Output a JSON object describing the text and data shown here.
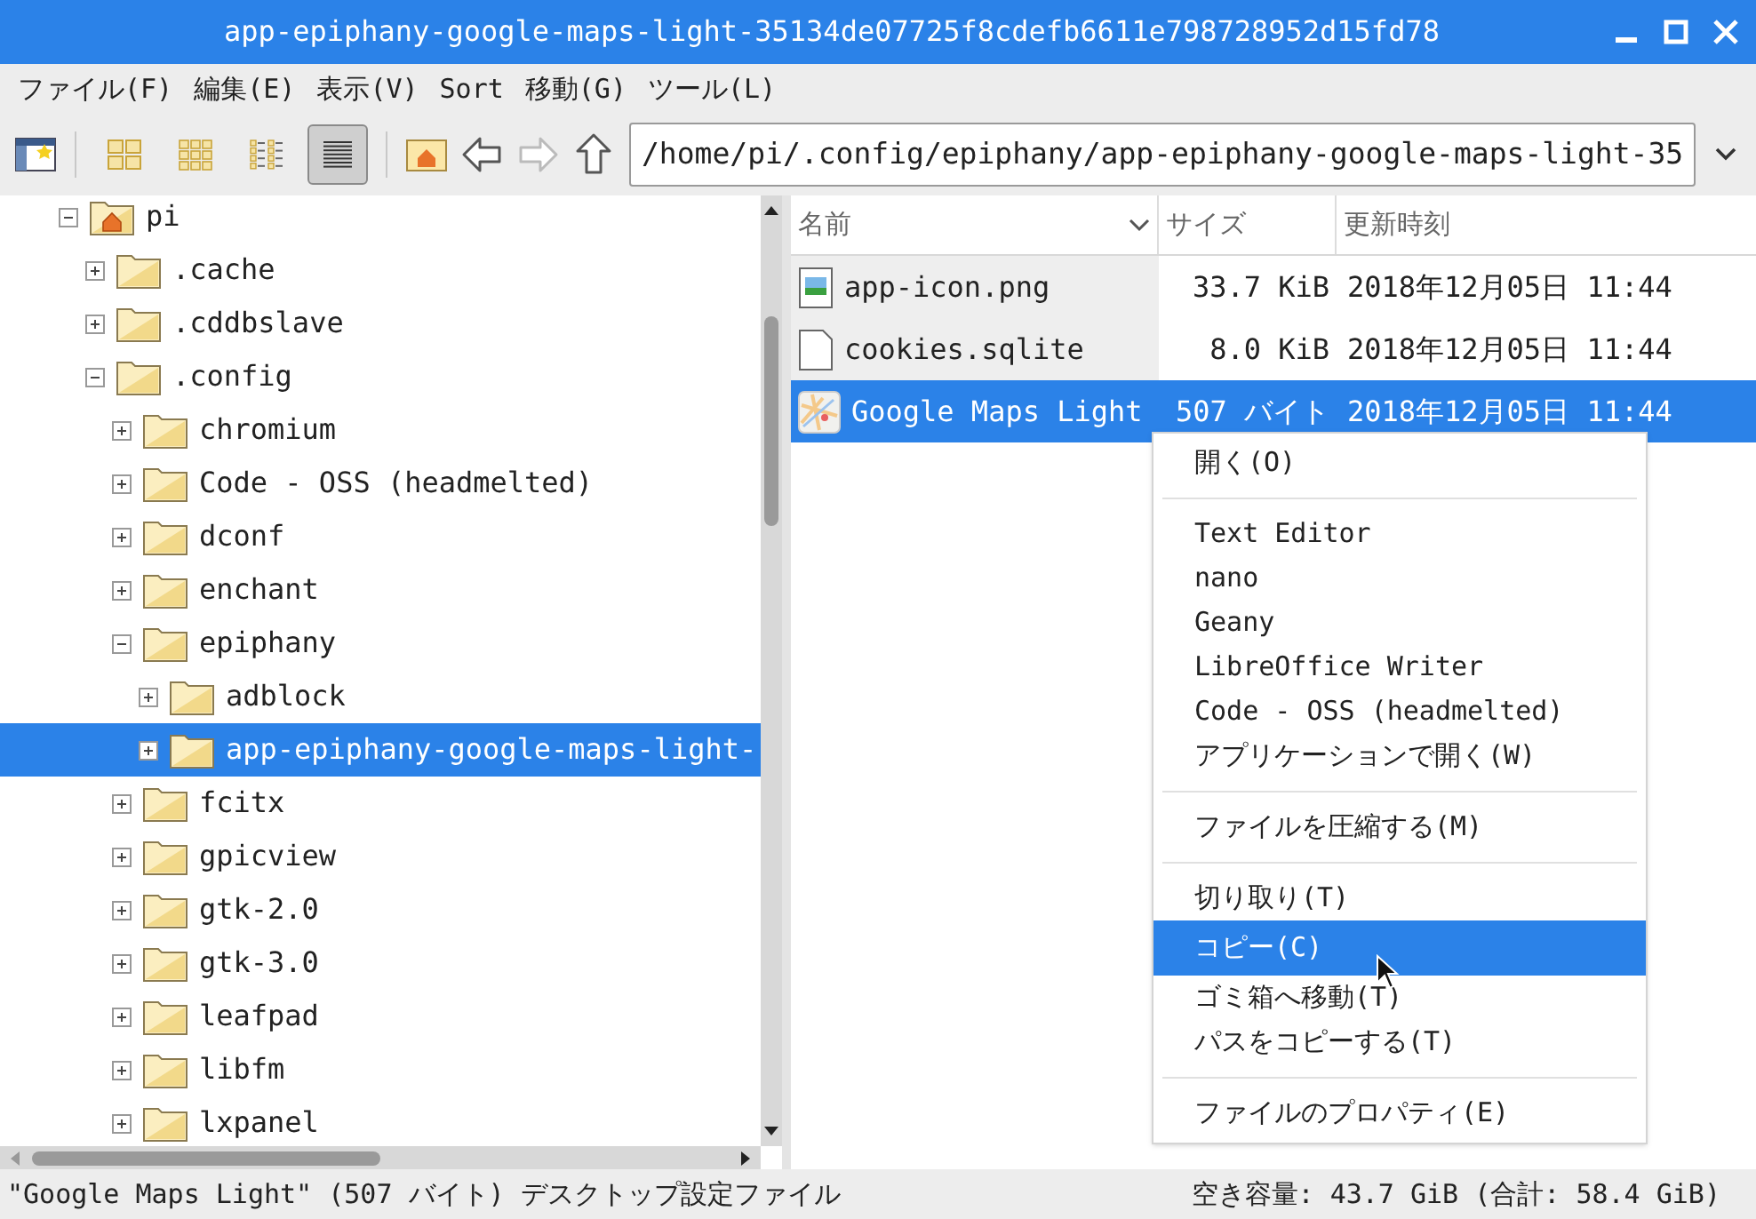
{
  "window": {
    "title": "app-epiphany-google-maps-light-35134de07725f8cdefb6611e798728952d15fd78"
  },
  "menu_bar": [
    "ファイル(F)",
    "編集(E)",
    "表示(V)",
    "Sort",
    "移動(G)",
    "ツール(L)"
  ],
  "toolbar": {
    "view_buttons": [
      {
        "kind": "icons",
        "selected": false
      },
      {
        "kind": "thumbnails",
        "selected": false
      },
      {
        "kind": "compact",
        "selected": false
      },
      {
        "kind": "list",
        "selected": true
      }
    ],
    "forward_disabled": true,
    "path": "/home/pi/.config/epiphany/app-epiphany-google-maps-light-35"
  },
  "tree": [
    {
      "label": "pi",
      "kind": "home",
      "expanded": true,
      "selected": false,
      "children": [
        {
          "label": ".cache",
          "kind": "folder",
          "expanded": false,
          "selected": false
        },
        {
          "label": ".cddbslave",
          "kind": "folder",
          "expanded": false,
          "selected": false
        },
        {
          "label": ".config",
          "kind": "folder",
          "expanded": true,
          "selected": false,
          "children": [
            {
              "label": "chromium",
              "kind": "folder",
              "expanded": false,
              "selected": false
            },
            {
              "label": "Code - OSS (headmelted)",
              "kind": "folder",
              "expanded": false,
              "selected": false
            },
            {
              "label": "dconf",
              "kind": "folder",
              "expanded": false,
              "selected": false
            },
            {
              "label": "enchant",
              "kind": "folder",
              "expanded": false,
              "selected": false
            },
            {
              "label": "epiphany",
              "kind": "folder",
              "expanded": true,
              "selected": false,
              "children": [
                {
                  "label": "adblock",
                  "kind": "folder",
                  "expanded": false,
                  "selected": false
                },
                {
                  "label": "app-epiphany-google-maps-light-",
                  "kind": "folder",
                  "expanded": false,
                  "selected": true
                }
              ]
            },
            {
              "label": "fcitx",
              "kind": "folder",
              "expanded": false,
              "selected": false
            },
            {
              "label": "gpicview",
              "kind": "folder",
              "expanded": false,
              "selected": false
            },
            {
              "label": "gtk-2.0",
              "kind": "folder",
              "expanded": false,
              "selected": false
            },
            {
              "label": "gtk-3.0",
              "kind": "folder",
              "expanded": false,
              "selected": false
            },
            {
              "label": "leafpad",
              "kind": "folder",
              "expanded": false,
              "selected": false
            },
            {
              "label": "libfm",
              "kind": "folder",
              "expanded": false,
              "selected": false
            },
            {
              "label": "lxpanel",
              "kind": "folder",
              "expanded": false,
              "selected": false
            }
          ]
        }
      ]
    }
  ],
  "table": {
    "columns": [
      "名前",
      "サイズ",
      "更新時刻"
    ],
    "rows": [
      {
        "kind": "image",
        "name": "app-icon.png",
        "size": "33.7 KiB",
        "modified": "2018年12月05日 11:44",
        "selected": false
      },
      {
        "kind": "file",
        "name": "cookies.sqlite",
        "size": "8.0 KiB",
        "modified": "2018年12月05日 11:44",
        "selected": false
      },
      {
        "kind": "map",
        "name": "Google Maps Light",
        "size": "507 バイト",
        "modified": "2018年12月05日 11:44",
        "selected": true
      }
    ]
  },
  "context_menu": {
    "groups": [
      [
        {
          "label": "開く(O)",
          "selected": false
        }
      ],
      [
        {
          "label": "Text Editor",
          "selected": false
        },
        {
          "label": "nano",
          "selected": false
        },
        {
          "label": "Geany",
          "selected": false
        },
        {
          "label": "LibreOffice Writer",
          "selected": false
        },
        {
          "label": "Code - OSS (headmelted)",
          "selected": false
        },
        {
          "label": "アプリケーションで開く(W)",
          "selected": false
        }
      ],
      [
        {
          "label": "ファイルを圧縮する(M)",
          "selected": false
        }
      ],
      [
        {
          "label": "切り取り(T)",
          "selected": false
        },
        {
          "label": "コピー(C)",
          "selected": true
        },
        {
          "label": "ゴミ箱へ移動(T)",
          "selected": false
        },
        {
          "label": "パスをコピーする(T)",
          "selected": false
        }
      ],
      [
        {
          "label": "ファイルのプロパティ(E)",
          "selected": false
        }
      ]
    ]
  },
  "status_bar": {
    "left": "\"Google Maps Light\" (507 バイト) デスクトップ設定ファイル",
    "right": "空き容量: 43.7 GiB (合計: 58.4 GiB)"
  }
}
